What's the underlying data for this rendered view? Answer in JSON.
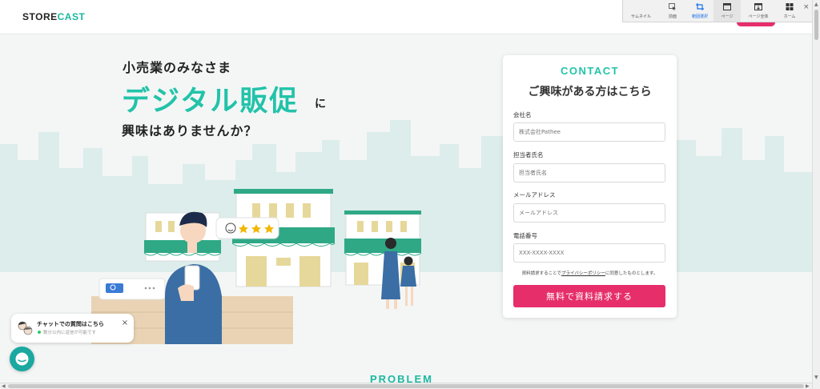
{
  "header": {
    "logo_part1": "STORE",
    "logo_part2": "CAST"
  },
  "toolbar": {
    "items": [
      {
        "label": "サムネイル",
        "icon": "thumbnail-icon"
      },
      {
        "label": "前面",
        "icon": "cursor-icon"
      },
      {
        "label": "範囲選択",
        "icon": "crop-icon"
      },
      {
        "label": "ページ",
        "icon": "page-icon"
      },
      {
        "label": "ページ全体",
        "icon": "full-page-icon"
      },
      {
        "label": "ホーム",
        "icon": "home-grid-icon"
      }
    ],
    "close": "×"
  },
  "hero": {
    "sub": "小売業のみなさま",
    "main": "デジタル販促",
    "ni": "に",
    "tail": "興味はありませんか？"
  },
  "contact": {
    "eyebrow": "CONTACT",
    "title": "ご興味がある方はこちら",
    "fields": [
      {
        "label": "会社名",
        "placeholder": "株式会社Pathee"
      },
      {
        "label": "担当者氏名",
        "placeholder": "担当者氏名"
      },
      {
        "label": "メールアドレス",
        "placeholder": "メールアドレス"
      },
      {
        "label": "電話番号",
        "placeholder": "XXX-XXXX-XXXX"
      }
    ],
    "consent_pre": "資料請求することで",
    "consent_link": "プライバシーポリシー",
    "consent_post": "に同意したものとします。",
    "submit": "無料で資料請求する"
  },
  "chat": {
    "title": "チャットでの質問はこちら",
    "status": "数分以内に返信が可能です",
    "close": "×"
  },
  "section": {
    "problem": "PROBLEM"
  },
  "colors": {
    "accent": "#22c3a9",
    "cta": "#e62e6b",
    "chat": "#1aa8a0"
  }
}
